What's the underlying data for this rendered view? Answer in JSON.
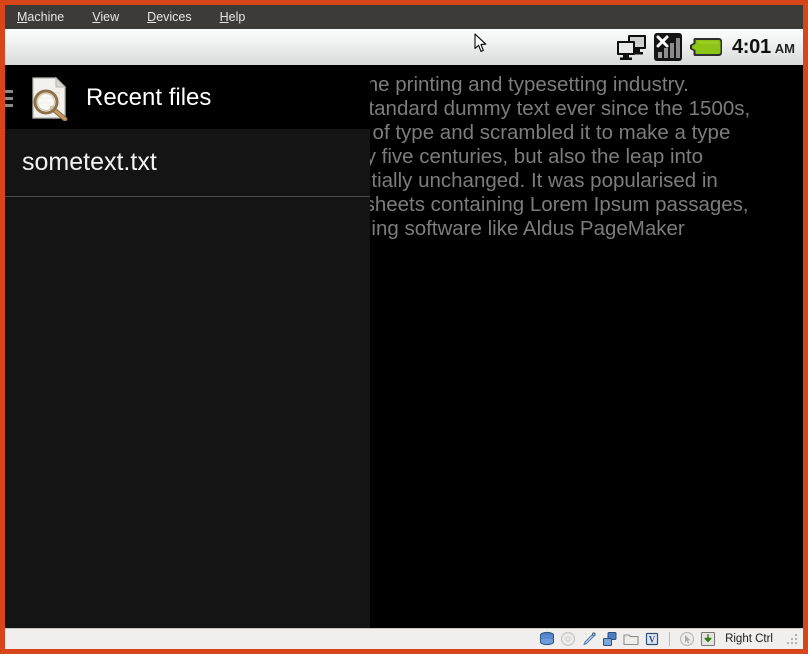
{
  "window": {
    "frame_color": "#d9451a",
    "menubar": {
      "background": "#3c3b37",
      "items": [
        {
          "name": "machine",
          "mnemonic": "M",
          "rest": "achine"
        },
        {
          "name": "view",
          "mnemonic": "V",
          "rest": "iew"
        },
        {
          "name": "devices",
          "mnemonic": "D",
          "rest": "evices"
        },
        {
          "name": "help",
          "mnemonic": "H",
          "rest": "elp"
        }
      ]
    }
  },
  "guest": {
    "status_bar": {
      "icons": [
        {
          "name": "adb-connected-icon",
          "label": "adb connected"
        },
        {
          "name": "signal-no-service-icon",
          "label": "no signal"
        },
        {
          "name": "battery-full-icon",
          "label": "battery full",
          "color": "#8cc417"
        }
      ],
      "clock": {
        "time": "4:01",
        "ampm": "AM"
      }
    },
    "document_text": "Lorem Ipsum is simply dummy text of the printing and typesetting industry.\nLorem Ipsum has been the industry's standard dummy text ever since the 1500s,\nwhen an unknown printer took a galley of type and scrambled it to make a type\nspecimen book. It has survived not only five centuries, but also the leap into\nelectronic typesetting, remaining essentially unchanged. It was popularised in\nthe 1960s with the release of Letraset sheets containing Lorem Ipsum passages,\nand more recently with desktop publishing software like Aldus PageMaker",
    "recent_panel": {
      "title": "Recent files",
      "title_icon": "document-search-icon",
      "menu_icon": "hamburger-menu-icon",
      "files": [
        {
          "name": "sometext.txt"
        }
      ]
    }
  },
  "vbox_status_bar": {
    "icons": [
      {
        "name": "hard-disk-icon",
        "label": "Hard Disks"
      },
      {
        "name": "optical-drive-icon",
        "label": "Optical Drives"
      },
      {
        "name": "usb-icon",
        "label": "USB Devices"
      },
      {
        "name": "network-icon",
        "label": "Network Adapters"
      },
      {
        "name": "shared-folders-icon",
        "label": "Shared Folders"
      },
      {
        "name": "video-capture-icon",
        "label": "Display"
      },
      {
        "name": "mouse-integration-icon",
        "label": "Mouse Integration"
      },
      {
        "name": "host-key-icon",
        "label": "Host Key"
      }
    ],
    "host_key_label": "Right Ctrl"
  }
}
